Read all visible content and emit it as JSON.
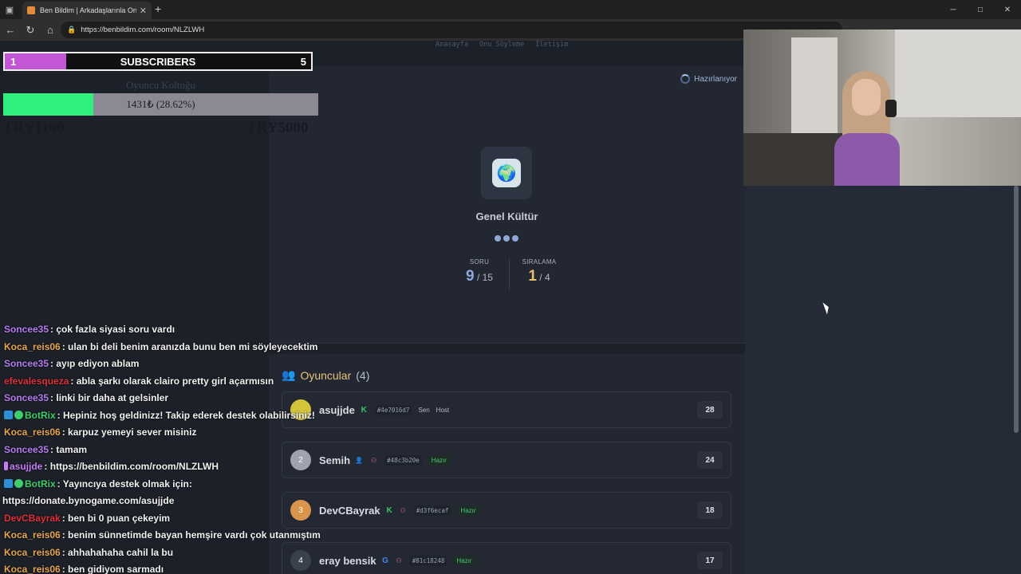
{
  "browser": {
    "tab_title": "Ben Bildim | Arkadaşlarınla Online",
    "new_tab": "+",
    "url": "https://benbildim.com/room/NLZLWH",
    "window_controls": [
      "─",
      "□",
      "✕"
    ]
  },
  "site_nav": [
    "Anasayfa",
    "Onu Söyleme",
    "İletişim"
  ],
  "game": {
    "status": "Hazırlanıyor",
    "category": "Genel Kültür",
    "question_label": "SORU",
    "question_current": "9",
    "question_total": "/ 15",
    "rank_label": "SIRALAMA",
    "rank_current": "1",
    "rank_total": "/ 4"
  },
  "players": {
    "title": "Oyuncular",
    "count": "(4)",
    "list": [
      {
        "avatar": "",
        "avatar_color": "#d4c43a",
        "name": "asujjde",
        "badge": "K",
        "badge_color": "#38c46a",
        "id": "#4e7016d7",
        "tags": [
          "Sen",
          "Host"
        ],
        "ready": "",
        "score": "28"
      },
      {
        "avatar": "2",
        "avatar_color": "#9ea3ad",
        "name": "Semih",
        "badge": "",
        "badge_color": "",
        "id": "#48c3b20e",
        "tags": [],
        "ready": "Hazır",
        "score": "24"
      },
      {
        "avatar": "3",
        "avatar_color": "#d9954a",
        "name": "DevCBayrak",
        "badge": "K",
        "badge_color": "#38c46a",
        "id": "#d3f6ecaf",
        "tags": [],
        "ready": "Hazır",
        "score": "18"
      },
      {
        "avatar": "4",
        "avatar_color": "#3a404c",
        "name": "eray bensik",
        "badge": "G",
        "badge_color": "#4285f4",
        "id": "#81c18248",
        "tags": [],
        "ready": "Hazır",
        "score": "17"
      }
    ]
  },
  "subs_goal": {
    "current": "1",
    "label": "SUBSCRIBERS",
    "goal": "5",
    "progress": 0.2
  },
  "donation": {
    "title": "Oyuncu Koltuğu",
    "amount": "1431₺ (28.62%)",
    "progress": 0.2862,
    "min": "TRY1100",
    "max": "TRY5000"
  },
  "chat": [
    {
      "user": "Soncee35",
      "color": "#b57cf0",
      "text": ": çok fazla siyasi soru vardı",
      "badge": ""
    },
    {
      "user": "Koca_reis06",
      "color": "#e8a64a",
      "text": ": ulan bi deli benim aranızda bunu ben mi söyleyecektim",
      "badge": ""
    },
    {
      "user": "Soncee35",
      "color": "#b57cf0",
      "text": ": ayıp ediyon ablam",
      "badge": ""
    },
    {
      "user": "efevalesqueza",
      "color": "#e0303a",
      "text": ": abla şarkı olarak clairo pretty girl açarmısın",
      "badge": ""
    },
    {
      "user": "Soncee35",
      "color": "#b57cf0",
      "text": ": linki bir daha at gelsinler",
      "badge": ""
    },
    {
      "user": "BotRix",
      "color": "#3ecf6c",
      "text": ": Hepiniz hoş geldinizz! Takip ederek destek olabilirsiniz!",
      "badge": "bot"
    },
    {
      "user": "Koca_reis06",
      "color": "#e8a64a",
      "text": ": karpuz yemeyi sever misiniz",
      "badge": ""
    },
    {
      "user": "Soncee35",
      "color": "#b57cf0",
      "text": ": tamam",
      "badge": ""
    },
    {
      "user": "asujjde",
      "color": "#c77cf5",
      "text": ": https://benbildim.com/room/NLZLWH",
      "badge": "streamer"
    },
    {
      "user": "BotRix",
      "color": "#3ecf6c",
      "text": ": Yayıncıya destek olmak için:",
      "badge": "bot"
    },
    {
      "user": "",
      "color": "#f2f2f2",
      "text": "https://donate.bynogame.com/asujjde",
      "badge": ""
    },
    {
      "user": "DevCBayrak",
      "color": "#e0303a",
      "text": ": ben bi 0 puan çekeyim",
      "badge": ""
    },
    {
      "user": "Koca_reis06",
      "color": "#e8a64a",
      "text": ": benim sünnetimde bayan hemşire vardı çok utanmıştım",
      "badge": ""
    },
    {
      "user": "Koca_reis06",
      "color": "#e8a64a",
      "text": ": ahhahahaha cahil la bu",
      "badge": ""
    },
    {
      "user": "Koca_reis06",
      "color": "#e8a64a",
      "text": ": ben gidiyom sarmadı",
      "badge": ""
    }
  ]
}
